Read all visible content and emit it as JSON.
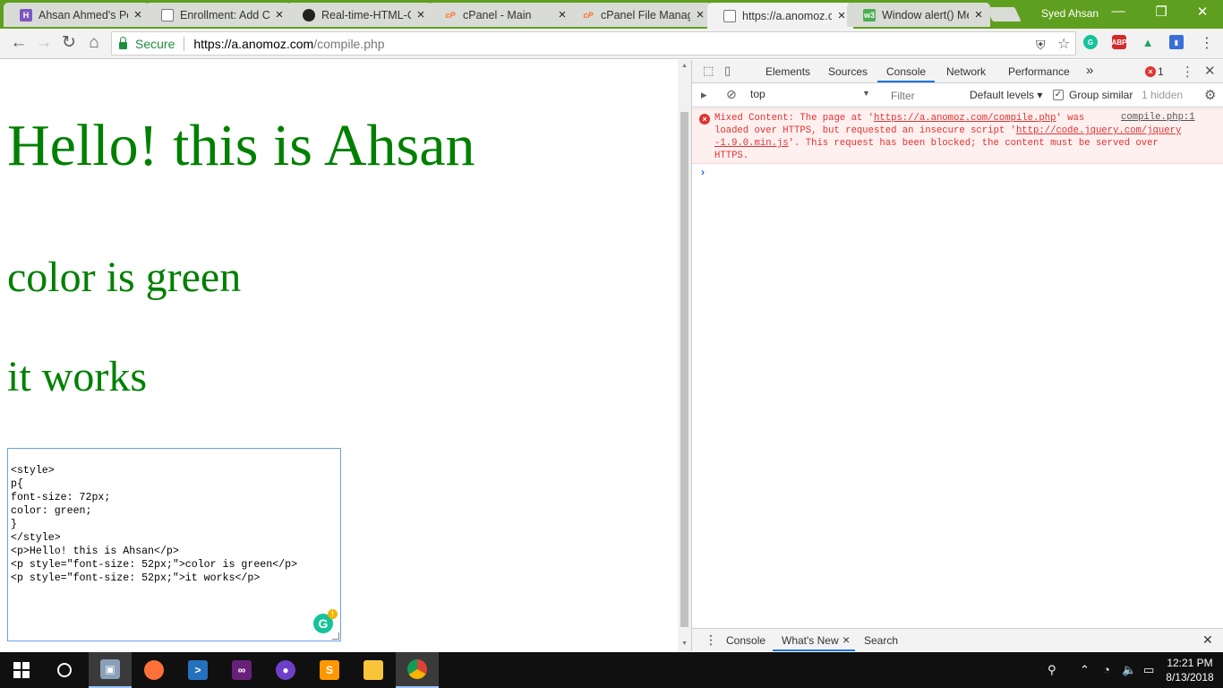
{
  "tabs": [
    {
      "title": "Ahsan Ahmed's Po",
      "icon": "h-site-icon",
      "favicon_text": "H",
      "color": "#7e57c2"
    },
    {
      "title": "Enrollment: Add C",
      "icon": "page-icon",
      "favicon_text": "",
      "color": "#777777"
    },
    {
      "title": "Real-time-HTML-C",
      "icon": "github-icon",
      "favicon_text": "●",
      "color": "#222222"
    },
    {
      "title": "cPanel - Main",
      "icon": "cpanel-icon",
      "favicon_text": "cP",
      "color": "#ff6c2c"
    },
    {
      "title": "cPanel File Manag",
      "icon": "cpanel-icon",
      "favicon_text": "cP",
      "color": "#ff6c2c"
    },
    {
      "title": "https://a.anomoz.c",
      "icon": "page-icon",
      "favicon_text": "",
      "color": "#777777"
    },
    {
      "title": "Window alert() Me",
      "icon": "w3schools-icon",
      "favicon_text": "w3",
      "color": "#4caf50"
    }
  ],
  "profile_name": "Syed Ahsan",
  "window_controls": {
    "minimize": "—",
    "restore": "❐",
    "close": "✕"
  },
  "toolbar": {
    "back": "←",
    "forward": "→",
    "reload": "↻",
    "home": "⌂",
    "secure_label": "Secure",
    "url_host": "https://a.anomoz.com",
    "url_path": "/compile.php",
    "star": "☆"
  },
  "page": {
    "heading": "Hello! this is Ahsan",
    "line2": "color is green",
    "line3": "it works",
    "text_color": "#008000",
    "code_lines": [
      "<style>",
      "p{",
      "font-size: 72px;",
      "color: green;",
      "}",
      "</style>",
      "<p>Hello! this is Ahsan</p>",
      "<p style=\"font-size: 52px;\">color is green</p>",
      "<p style=\"font-size: 52px;\">it works</p>"
    ],
    "grammarly_letter": "G",
    "grammarly_badge": "!"
  },
  "devtools": {
    "tabs": [
      "Elements",
      "Sources",
      "Console",
      "Network",
      "Performance"
    ],
    "active_tab": "Console",
    "more_tabs": "»",
    "error_count": "1",
    "context": "top",
    "filter_placeholder": "Filter",
    "levels": "Default levels ▾",
    "group_similar": "Group similar",
    "hidden_count": "1 hidden",
    "error": {
      "line1_a": "Mixed Content: The page at '",
      "line1_link": "https://a.anomoz.com/compile.php",
      "line1_b": "' was",
      "line2_a": "loaded over HTTPS, but requested an insecure script '",
      "line2_link": "http://code.jquery.com/jquery",
      "line3_link": "-1.9.0.min.js",
      "line3_b": "'. This request has been blocked; the content must be served over",
      "line4": "HTTPS.",
      "source": "compile.php:1"
    },
    "prompt": "›",
    "drawer_tabs": [
      "Console",
      "What's New",
      "Search"
    ],
    "drawer_close": "×"
  },
  "taskbar": {
    "clock_time": "12:21 PM",
    "clock_date": "8/13/2018"
  }
}
